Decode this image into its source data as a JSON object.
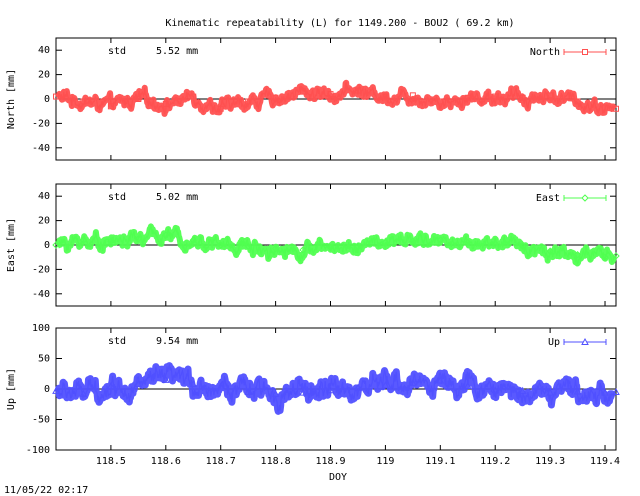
{
  "title": "Kinematic repeatability (L) for 1149.200 - BOU2  ( 69.2 km)",
  "timestamp": "11/05/22 02:17",
  "chart_data": [
    {
      "type": "line",
      "ylabel": "North [mm]",
      "ylim": [
        -50,
        50
      ],
      "yticks": [
        "40",
        "20",
        "0",
        "-20",
        "-40"
      ],
      "ytick_values": [
        40,
        20,
        0,
        -20,
        -40
      ],
      "xlim": [
        118.4,
        119.42
      ],
      "std_label": "std",
      "std_value": "5.52 mm",
      "legend": "North",
      "legend_position": "top-right",
      "color": "#ff5050",
      "marker": "square",
      "series": [
        {
          "name": "North",
          "x": [
            118.4,
            118.45,
            118.5,
            118.55,
            118.6,
            118.65,
            118.7,
            118.75,
            118.8,
            118.85,
            118.9,
            118.95,
            119.0,
            119.05,
            119.1,
            119.15,
            119.2,
            119.25,
            119.3,
            119.35,
            119.4,
            119.42
          ],
          "y": [
            2,
            -2,
            -6,
            0,
            -4,
            2,
            -8,
            -2,
            1,
            6,
            4,
            7,
            2,
            3,
            -2,
            1,
            2,
            1,
            3,
            -2,
            -7,
            -8
          ]
        }
      ]
    },
    {
      "type": "line",
      "ylabel": "East [mm]",
      "ylim": [
        -50,
        50
      ],
      "yticks": [
        "40",
        "20",
        "0",
        "-20",
        "-40"
      ],
      "ytick_values": [
        40,
        20,
        0,
        -20,
        -40
      ],
      "xlim": [
        118.4,
        119.42
      ],
      "std_label": "std",
      "std_value": "5.02 mm",
      "legend": "East",
      "legend_position": "top-right",
      "color": "#50ff50",
      "marker": "diamond",
      "series": [
        {
          "name": "East",
          "x": [
            118.4,
            118.45,
            118.5,
            118.55,
            118.6,
            118.65,
            118.7,
            118.75,
            118.8,
            118.85,
            118.9,
            118.95,
            119.0,
            119.05,
            119.1,
            119.15,
            119.2,
            119.25,
            119.3,
            119.35,
            119.4,
            119.42
          ],
          "y": [
            0,
            4,
            3,
            5,
            8,
            4,
            0,
            -1,
            -3,
            -4,
            -2,
            -1,
            2,
            3,
            4,
            2,
            1,
            -1,
            -5,
            -8,
            -10,
            -9
          ]
        }
      ]
    },
    {
      "type": "line",
      "ylabel": "Up [mm]",
      "ylim": [
        -100,
        100
      ],
      "yticks": [
        "100",
        "50",
        "0",
        "-50",
        "-100"
      ],
      "ytick_values": [
        100,
        50,
        0,
        -50,
        -100
      ],
      "xlim": [
        118.4,
        119.42
      ],
      "std_label": "std",
      "std_value": "9.54 mm",
      "legend": "Up",
      "legend_position": "top-right",
      "color": "#5050ff",
      "marker": "triangle",
      "xlabel": "DOY",
      "xticks": [
        "118.5",
        "118.6",
        "118.7",
        "118.8",
        "118.9",
        "119",
        "119.1",
        "119.2",
        "119.3",
        "119.4"
      ],
      "xtick_values": [
        118.5,
        118.6,
        118.7,
        118.8,
        118.9,
        119.0,
        119.1,
        119.2,
        119.3,
        119.4
      ],
      "series": [
        {
          "name": "Up",
          "x": [
            118.4,
            118.45,
            118.5,
            118.55,
            118.6,
            118.65,
            118.7,
            118.75,
            118.8,
            118.85,
            118.9,
            118.95,
            119.0,
            119.05,
            119.1,
            119.15,
            119.2,
            119.25,
            119.3,
            119.35,
            119.4,
            119.42
          ],
          "y": [
            -3,
            -8,
            5,
            8,
            15,
            8,
            4,
            -5,
            -8,
            -6,
            -2,
            2,
            6,
            10,
            14,
            5,
            -2,
            -3,
            -6,
            -4,
            -6,
            -5
          ]
        }
      ]
    }
  ]
}
